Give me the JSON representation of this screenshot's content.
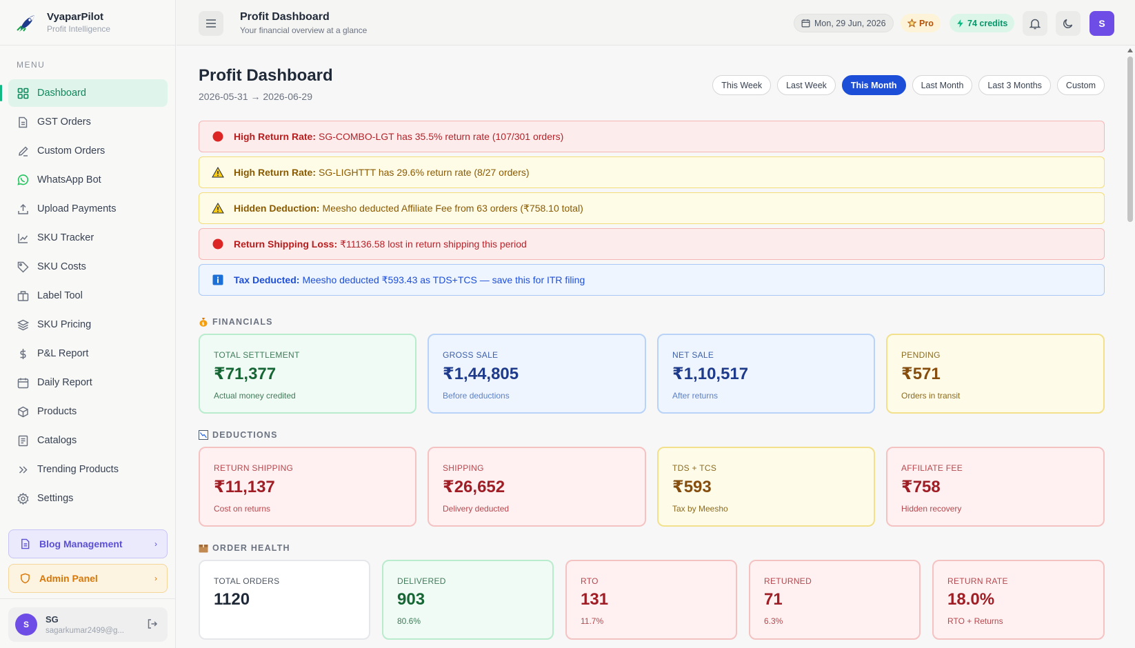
{
  "brand": {
    "name": "VyaparPilot",
    "tagline": "Profit Intelligence"
  },
  "sidebar": {
    "menu_label": "MENU",
    "items": [
      {
        "label": "Dashboard",
        "icon": "grid-icon",
        "active": true
      },
      {
        "label": "GST Orders",
        "icon": "document-icon"
      },
      {
        "label": "Custom Orders",
        "icon": "pencil-icon"
      },
      {
        "label": "WhatsApp Bot",
        "icon": "whatsapp-icon"
      },
      {
        "label": "Upload Payments",
        "icon": "upload-icon"
      },
      {
        "label": "SKU Tracker",
        "icon": "line-chart-icon"
      },
      {
        "label": "SKU Costs",
        "icon": "tag-icon"
      },
      {
        "label": "Label Tool",
        "icon": "package-icon"
      },
      {
        "label": "SKU Pricing",
        "icon": "layers-icon"
      },
      {
        "label": "P&L Report",
        "icon": "dollar-icon"
      },
      {
        "label": "Daily Report",
        "icon": "calendar-icon"
      },
      {
        "label": "Products",
        "icon": "box-icon"
      },
      {
        "label": "Catalogs",
        "icon": "list-icon"
      },
      {
        "label": "Trending Products",
        "icon": "chevrons-right-icon"
      },
      {
        "label": "Settings",
        "icon": "gear-icon"
      }
    ],
    "blog_label": "Blog Management",
    "admin_label": "Admin Panel",
    "user": {
      "initial": "S",
      "name": "SG",
      "email": "sagarkumar2499@g..."
    }
  },
  "header": {
    "title": "Profit Dashboard",
    "subtitle": "Your financial overview at a glance",
    "date": "Mon, 29 Jun, 2026",
    "plan": "Pro",
    "credits": "74 credits",
    "avatar": "S"
  },
  "main": {
    "title": "Profit Dashboard",
    "range": "2026-05-31 → 2026-06-29",
    "periods": [
      "This Week",
      "Last Week",
      "This Month",
      "Last Month",
      "Last 3 Months",
      "Custom"
    ],
    "active_period": "This Month",
    "alerts": [
      {
        "type": "red",
        "title": "High Return Rate:",
        "text": "SG-COMBO-LGT has 35.5% return rate (107/301 orders)"
      },
      {
        "type": "yellow",
        "title": "High Return Rate:",
        "text": "SG-LIGHTTT has 29.6% return rate (8/27 orders)"
      },
      {
        "type": "yellow",
        "title": "Hidden Deduction:",
        "text": "Meesho deducted Affiliate Fee from 63 orders (₹758.10 total)"
      },
      {
        "type": "red",
        "title": "Return Shipping Loss:",
        "text": "₹11136.58 lost in return shipping this period"
      },
      {
        "type": "blue",
        "title": "Tax Deducted:",
        "text": "Meesho deducted ₹593.43 as TDS+TCS — save this for ITR filing"
      }
    ],
    "sections": {
      "financials": {
        "label": "FINANCIALS",
        "cards": [
          {
            "label": "TOTAL SETTLEMENT",
            "value": "₹71,377",
            "sub": "Actual money credited",
            "tone": "green"
          },
          {
            "label": "GROSS SALE",
            "value": "₹1,44,805",
            "sub": "Before deductions",
            "tone": "blue"
          },
          {
            "label": "NET SALE",
            "value": "₹1,10,517",
            "sub": "After returns",
            "tone": "blue"
          },
          {
            "label": "PENDING",
            "value": "₹571",
            "sub": "Orders in transit",
            "tone": "yellow"
          }
        ]
      },
      "deductions": {
        "label": "DEDUCTIONS",
        "cards": [
          {
            "label": "RETURN SHIPPING",
            "value": "₹11,137",
            "sub": "Cost on returns",
            "tone": "red"
          },
          {
            "label": "SHIPPING",
            "value": "₹26,652",
            "sub": "Delivery deducted",
            "tone": "red"
          },
          {
            "label": "TDS + TCS",
            "value": "₹593",
            "sub": "Tax by Meesho",
            "tone": "yellow"
          },
          {
            "label": "AFFILIATE FEE",
            "value": "₹758",
            "sub": "Hidden recovery",
            "tone": "red"
          }
        ]
      },
      "order_health": {
        "label": "ORDER HEALTH",
        "cards": [
          {
            "label": "TOTAL ORDERS",
            "value": "1120",
            "sub": "",
            "tone": "white"
          },
          {
            "label": "DELIVERED",
            "value": "903",
            "sub": "80.6%",
            "tone": "green"
          },
          {
            "label": "RTO",
            "value": "131",
            "sub": "11.7%",
            "tone": "red"
          },
          {
            "label": "RETURNED",
            "value": "71",
            "sub": "6.3%",
            "tone": "red"
          },
          {
            "label": "RETURN RATE",
            "value": "18.0%",
            "sub": "RTO + Returns",
            "tone": "red"
          }
        ]
      }
    }
  }
}
